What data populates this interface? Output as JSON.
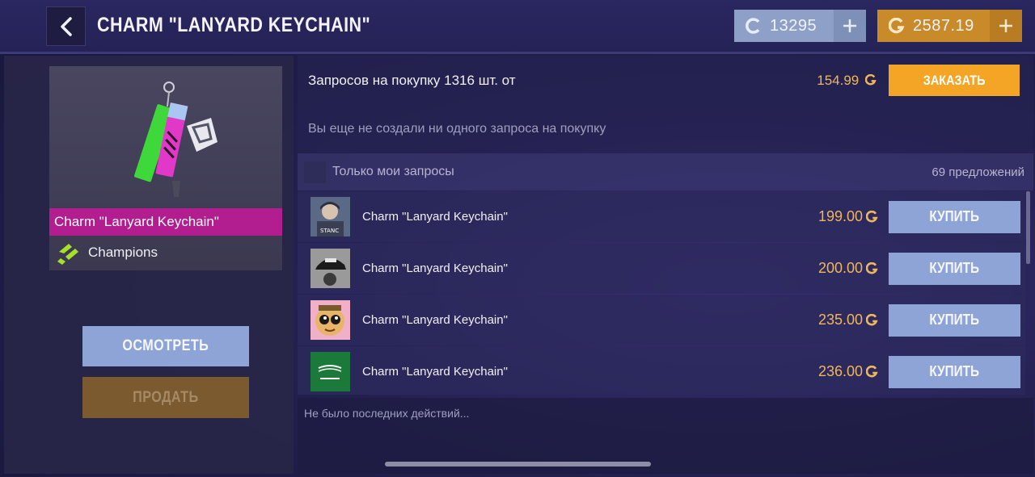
{
  "header": {
    "title": "CHARM \"LANYARD KEYCHAIN\"",
    "silver_amount": "13295",
    "gold_amount": "2587.19"
  },
  "item": {
    "name": "Charm \"Lanyard Keychain\"",
    "collection": "Champions",
    "rarity_color": "#b21d8f"
  },
  "actions": {
    "inspect_label": "ОСМОТРЕТЬ",
    "sell_label": "ПРОДАТЬ"
  },
  "buy_requests": {
    "summary": "Запросов на покупку 1316 шт. от",
    "min_price": "154.99",
    "order_label": "ЗАКАЗАТЬ",
    "empty_text": "Вы еще не создали ни одного запроса на покупку"
  },
  "filter": {
    "only_mine_label": "Только мои запросы",
    "offer_count": "69 предложений"
  },
  "offers": [
    {
      "name": "Charm \"Lanyard Keychain\"",
      "price": "199.00",
      "buy_label": "КУПИТЬ",
      "avatar": "soldier-avatar"
    },
    {
      "name": "Charm \"Lanyard Keychain\"",
      "price": "200.00",
      "buy_label": "КУПИТЬ",
      "avatar": "cap-avatar"
    },
    {
      "name": "Charm \"Lanyard Keychain\"",
      "price": "235.00",
      "buy_label": "КУПИТЬ",
      "avatar": "cartoon-avatar"
    },
    {
      "name": "Charm \"Lanyard Keychain\"",
      "price": "236.00",
      "buy_label": "КУПИТЬ",
      "avatar": "flag-avatar"
    }
  ],
  "recent": {
    "text": "Не было последних действий..."
  },
  "colors": {
    "gold": "#f0b65a",
    "accent_button": "#8ea3d6",
    "order_button": "#f5a526"
  }
}
